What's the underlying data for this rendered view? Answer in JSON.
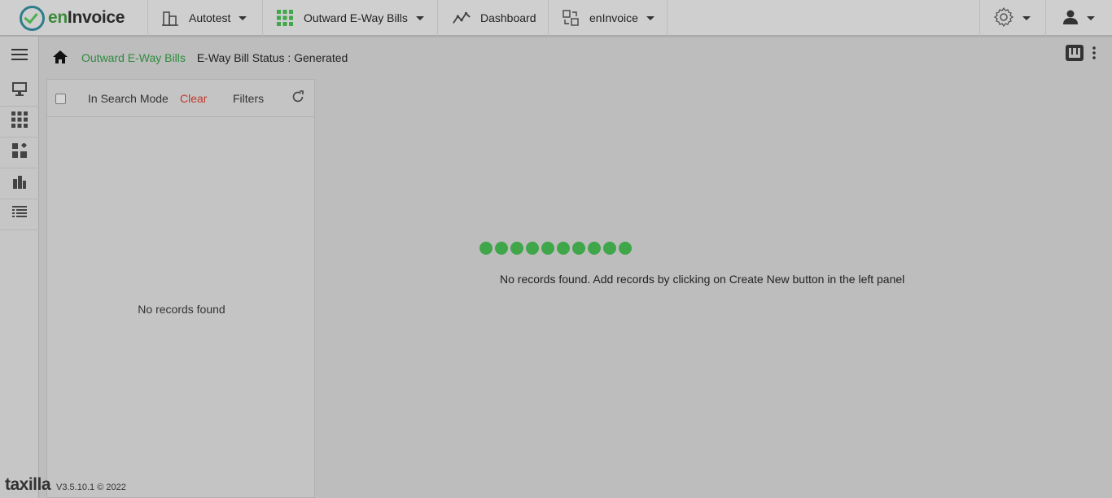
{
  "app": {
    "logo_prefix": "en",
    "logo_suffix": "Invoice"
  },
  "nav": {
    "items": [
      {
        "label": "Autotest",
        "icon": "building-icon"
      },
      {
        "label": "Outward E-Way Bills",
        "icon": "grid-icon"
      },
      {
        "label": "Dashboard",
        "icon": "trend-icon"
      },
      {
        "label": "enInvoice",
        "icon": "switch-icon"
      }
    ]
  },
  "breadcrumb": {
    "link": "Outward E-Way Bills",
    "current": "E-Way Bill Status : Generated"
  },
  "list": {
    "search_mode": "In Search Mode",
    "clear": "Clear",
    "filters": "Filters",
    "empty": "No records found"
  },
  "main": {
    "message": "No records found. Add records by clicking on Create New button in the left panel"
  },
  "loader": {
    "dots": 10
  },
  "footer": {
    "brand": "taxilla",
    "version": "V3.5.10.1 © 2022"
  },
  "colors": {
    "accent": "#2e8b3e",
    "danger": "#c0392b",
    "loader": "#3fa64a"
  }
}
